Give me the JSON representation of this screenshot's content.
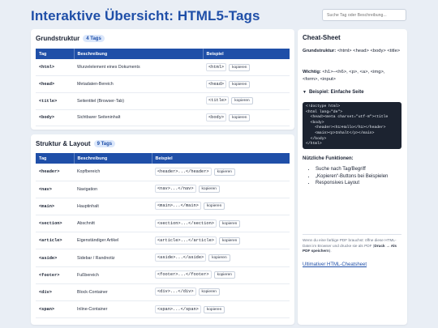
{
  "header": {
    "title": "Interaktive Übersicht: HTML5-Tags"
  },
  "search": {
    "placeholder": "Suche Tag oder Beschreibung..."
  },
  "sections": [
    {
      "title": "Grundstruktur",
      "badge": "4 Tags",
      "columns": [
        "Tag",
        "Beschreibung",
        "Beispiel"
      ],
      "rows": [
        {
          "tag": "<html>",
          "desc": "Wurzelelement eines Dokuments",
          "example": "<html>",
          "copy": "kopieren"
        },
        {
          "tag": "<head>",
          "desc": "Metadaten-Bereich",
          "example": "<head>",
          "copy": "kopieren"
        },
        {
          "tag": "<title>",
          "desc": "Seitentitel (Browser-Tab)",
          "example": "<title>",
          "copy": "kopieren"
        },
        {
          "tag": "<body>",
          "desc": "Sichtbarer Seiteninhalt",
          "example": "<body>",
          "copy": "kopieren"
        }
      ]
    },
    {
      "title": "Struktur & Layout",
      "badge": "9 Tags",
      "columns": [
        "Tag",
        "Beschreibung",
        "Beispiel"
      ],
      "rows": [
        {
          "tag": "<header>",
          "desc": "Kopfbereich",
          "example": "<header>...</header>",
          "copy": "kopieren"
        },
        {
          "tag": "<nav>",
          "desc": "Navigation",
          "example": "<nav>...</nav>",
          "copy": "kopieren"
        },
        {
          "tag": "<main>",
          "desc": "Hauptinhalt",
          "example": "<main>...</main>",
          "copy": "kopieren"
        },
        {
          "tag": "<section>",
          "desc": "Abschnitt",
          "example": "<section>...</section>",
          "copy": "kopieren"
        },
        {
          "tag": "<article>",
          "desc": "Eigenständiger Artikel",
          "example": "<article>...</article>",
          "copy": "kopieren"
        },
        {
          "tag": "<aside>",
          "desc": "Sidebar / Randnotiz",
          "example": "<aside>...</aside>",
          "copy": "kopieren"
        },
        {
          "tag": "<footer>",
          "desc": "Fußbereich",
          "example": "<footer>...</footer>",
          "copy": "kopieren"
        },
        {
          "tag": "<div>",
          "desc": "Block-Container",
          "example": "<div>...</div>",
          "copy": "kopieren"
        },
        {
          "tag": "<span>",
          "desc": "Inline-Container",
          "example": "<span>...</span>",
          "copy": "kopieren"
        }
      ]
    }
  ],
  "cheatsheet": {
    "title": "Cheat-Sheet",
    "grund_label": "Grundstruktur:",
    "grund_text": " <html> <head> <body> <title>",
    "wichtig_label": "Wichtig:",
    "wichtig_text": " <h1>–<h6>, <p>, <a>, <img>, <form>, <input>",
    "details_marker": "▼",
    "details_label": "Beispiel: Einfache Seite",
    "code_lines": [
      "<!doctype html>",
      "<html lang=\"de\">",
      "  <head><meta charset=\"utf-8\"><title",
      "  <body>",
      "    <header><h1>Hallo</h1></header>",
      "    <main><p>Inhalt</p></main>",
      "  </body>",
      "</html>"
    ],
    "features_title": "Nützliche Funktionen:",
    "features": [
      "Suche nach Tag/Begriff",
      "„Kopieren“-Buttons bei Beispielen",
      "Responsives Layout"
    ],
    "note_text": "Wenn du eine farbige PDF brauchst: öffne diese HTML-Datei im Browser und drucke sie als PDF (",
    "note_bold": "Druck → Als PDF speichern",
    "note_end": ").",
    "link": "Ultimativer HTML-Cheatsheet"
  },
  "colors": {
    "accent": "#1f4fa8",
    "background": "#e9eef5",
    "code_bg": "#1c2330"
  }
}
